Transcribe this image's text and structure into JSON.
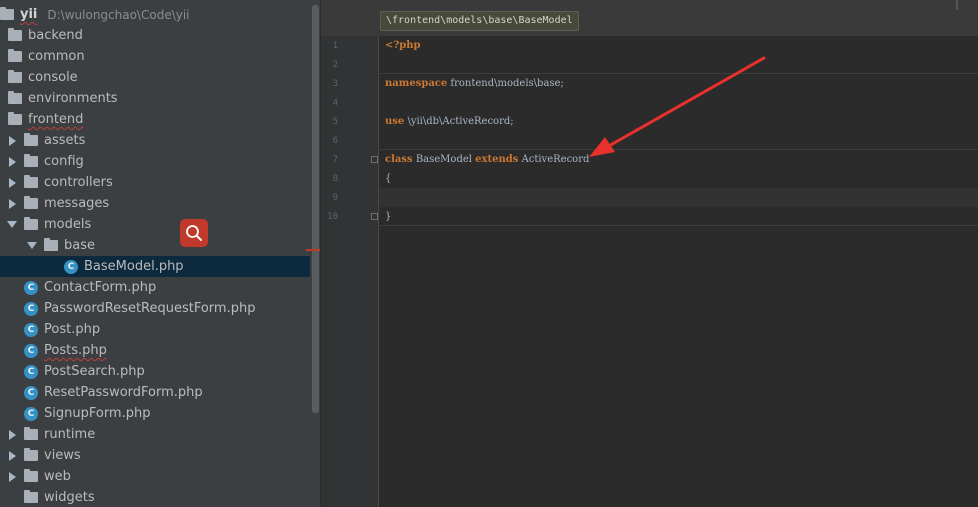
{
  "project": {
    "name": "yii",
    "path": "D:\\wulongchao\\Code\\yii"
  },
  "tree": [
    {
      "label": "backend",
      "type": "folder",
      "depth": 0,
      "arrow": "none"
    },
    {
      "label": "common",
      "type": "folder",
      "depth": 0,
      "arrow": "none"
    },
    {
      "label": "console",
      "type": "folder",
      "depth": 0,
      "arrow": "none"
    },
    {
      "label": "environments",
      "type": "folder",
      "depth": 0,
      "arrow": "none"
    },
    {
      "label": "frontend",
      "type": "folder",
      "depth": 0,
      "arrow": "none",
      "squiggle": true
    },
    {
      "label": "assets",
      "type": "folder",
      "depth": 1,
      "arrow": "right"
    },
    {
      "label": "config",
      "type": "folder",
      "depth": 1,
      "arrow": "right"
    },
    {
      "label": "controllers",
      "type": "folder",
      "depth": 1,
      "arrow": "right"
    },
    {
      "label": "messages",
      "type": "folder",
      "depth": 1,
      "arrow": "right"
    },
    {
      "label": "models",
      "type": "folder",
      "depth": 1,
      "arrow": "down"
    },
    {
      "label": "base",
      "type": "folder",
      "depth": 2,
      "arrow": "down"
    },
    {
      "label": "BaseModel.php",
      "type": "class",
      "depth": 3,
      "arrow": "none",
      "selected": true
    },
    {
      "label": "ContactForm.php",
      "type": "class",
      "depth": 2,
      "arrow": "none"
    },
    {
      "label": "PasswordResetRequestForm.php",
      "type": "class",
      "depth": 2,
      "arrow": "none"
    },
    {
      "label": "Post.php",
      "type": "class",
      "depth": 2,
      "arrow": "none"
    },
    {
      "label": "Posts.php",
      "type": "class",
      "depth": 2,
      "arrow": "none",
      "squiggle": true
    },
    {
      "label": "PostSearch.php",
      "type": "class",
      "depth": 2,
      "arrow": "none"
    },
    {
      "label": "ResetPasswordForm.php",
      "type": "class",
      "depth": 2,
      "arrow": "none"
    },
    {
      "label": "SignupForm.php",
      "type": "class",
      "depth": 2,
      "arrow": "none"
    },
    {
      "label": "runtime",
      "type": "folder",
      "depth": 1,
      "arrow": "right"
    },
    {
      "label": "views",
      "type": "folder",
      "depth": 1,
      "arrow": "right"
    },
    {
      "label": "web",
      "type": "folder",
      "depth": 1,
      "arrow": "right"
    },
    {
      "label": "widgets",
      "type": "folder",
      "depth": 1,
      "arrow": "none"
    }
  ],
  "class_icon_letter": "C",
  "editor": {
    "breadcrumb": "\\frontend\\models\\base\\BaseModel",
    "lines": [
      {
        "n": "1",
        "parts": [
          {
            "t": "<?php",
            "k": "kw"
          }
        ]
      },
      {
        "n": "2",
        "parts": []
      },
      {
        "n": "3",
        "parts": [
          {
            "t": "namespace",
            "k": "kw"
          },
          {
            "t": " frontend\\models\\base;",
            "k": ""
          }
        ]
      },
      {
        "n": "4",
        "parts": []
      },
      {
        "n": "5",
        "parts": [
          {
            "t": "use",
            "k": "kw"
          },
          {
            "t": " \\yii\\db\\ActiveRecord;",
            "k": ""
          }
        ]
      },
      {
        "n": "6",
        "parts": []
      },
      {
        "n": "7",
        "parts": [
          {
            "t": "class",
            "k": "kw"
          },
          {
            "t": " BaseModel ",
            "k": ""
          },
          {
            "t": "extends",
            "k": "kw"
          },
          {
            "t": " ActiveRecord",
            "k": ""
          }
        ]
      },
      {
        "n": "8",
        "parts": [
          {
            "t": "{",
            "k": ""
          }
        ]
      },
      {
        "n": "9",
        "parts": []
      },
      {
        "n": "10",
        "parts": [
          {
            "t": "}",
            "k": ""
          }
        ]
      }
    ],
    "caret_line": 9
  },
  "colors": {
    "keyword": "#cc7832",
    "text": "#a9b7c6",
    "annotation_arrow": "#e8302c",
    "selection": "#0d293e",
    "search_badge": "#c0392b"
  }
}
